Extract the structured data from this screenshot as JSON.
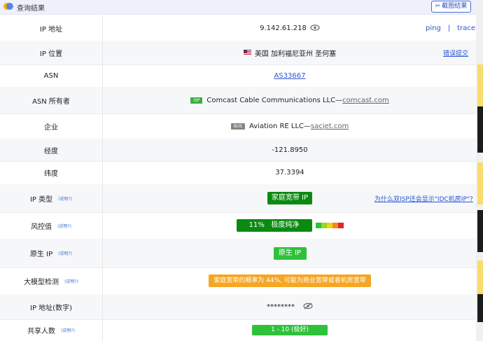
{
  "header": {
    "title": "查询结果",
    "screenshot_button": "截图结果"
  },
  "explain_text": "(说明?)",
  "rows": {
    "ip": {
      "label": "IP 地址",
      "value": "9.142.61.218",
      "ping": "ping",
      "sep": "|",
      "trace": "trace"
    },
    "location": {
      "label": "IP 位置",
      "value": "美国 加利福尼亚州 圣何塞",
      "report": "错误提交"
    },
    "asn": {
      "label": "ASN",
      "value": "AS33667"
    },
    "asn_owner": {
      "label": "ASN 所有者",
      "tag": "ISP",
      "name": "Comcast Cable Communications LLC",
      "dash": "— ",
      "domain": "comcast.com"
    },
    "company": {
      "label": "企业",
      "tag": "BUS",
      "name": "Aviation RE LLC",
      "dash": "— ",
      "domain": "sacjet.com"
    },
    "longitude": {
      "label": "经度",
      "value": "-121.8950"
    },
    "latitude": {
      "label": "纬度",
      "value": "37.3394"
    },
    "ip_type": {
      "label": "IP 类型",
      "value": "家庭宽带 IP",
      "question": "为什么双ISP还会显示\"IDC机房IP\"?"
    },
    "risk": {
      "label": "风控值",
      "percent": "11%",
      "level": "极度纯净"
    },
    "native": {
      "label": "原生 IP",
      "value": "原生 IP"
    },
    "llm": {
      "label": "大模型检测",
      "value": "家庭宽带的概率为 44%, 可能为商业宽带或者机房宽带"
    },
    "ip_numeric": {
      "label": "IP 地址(数字)",
      "value": "********"
    },
    "shared": {
      "label": "共享人数",
      "value": "1 - 10 (极好)"
    }
  },
  "colors": {
    "green_dark": "#0b8a12",
    "green_light": "#2ec23a",
    "orange": "#f5a623",
    "link_blue": "#2b57d0",
    "risk_scale": [
      "#25c43a",
      "#9ed41f",
      "#e9d619",
      "#f28a14",
      "#e3262a"
    ]
  },
  "icons": {
    "eye": "eye-icon",
    "eye_slash": "eye-slash-icon",
    "scissors": "scissors-icon"
  }
}
